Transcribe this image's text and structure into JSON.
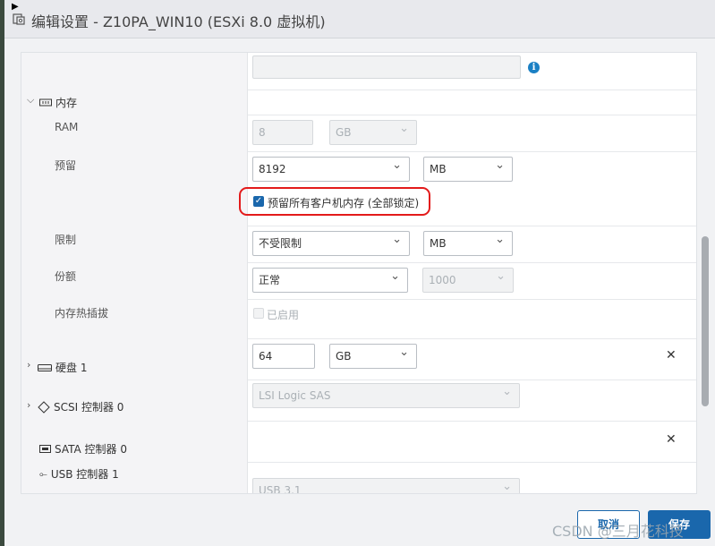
{
  "window": {
    "title": "编辑设置 - Z10PA_WIN10 (ESXi 8.0 虚拟机)"
  },
  "memory": {
    "section_label": "内存",
    "ram": {
      "label": "RAM",
      "value": "8",
      "unit": "GB"
    },
    "reservation": {
      "label": "预留",
      "value": "8192",
      "unit": "MB",
      "lock_all_checkbox_label": "预留所有客户机内存 (全部锁定)",
      "lock_all_checked": true
    },
    "limit": {
      "label": "限制",
      "value": "不受限制",
      "unit": "MB"
    },
    "shares": {
      "label": "份额",
      "value": "正常",
      "number": "1000"
    },
    "hot_plug": {
      "label": "内存热插拔",
      "checkbox_label": "已启用",
      "checked": false
    }
  },
  "hard_disk": {
    "label": "硬盘 1",
    "size": "64",
    "unit": "GB"
  },
  "scsi": {
    "label": "SCSI 控制器 0",
    "value": "LSI Logic SAS"
  },
  "sata": {
    "label": "SATA 控制器 0"
  },
  "usb": {
    "label": "USB 控制器 1",
    "value": "USB 3.1"
  },
  "footer": {
    "cancel_label": "取消",
    "save_label": "保存"
  },
  "watermark": "CSDN @三月花科技",
  "colors": {
    "primary": "#1a67ac",
    "highlight": "#e31b1b",
    "info": "#1b80c4"
  },
  "icons": [
    "vm-settings-icon",
    "info-icon",
    "memory-icon",
    "disk-icon",
    "scsi-icon",
    "sata-icon",
    "usb-icon",
    "close-icon"
  ]
}
